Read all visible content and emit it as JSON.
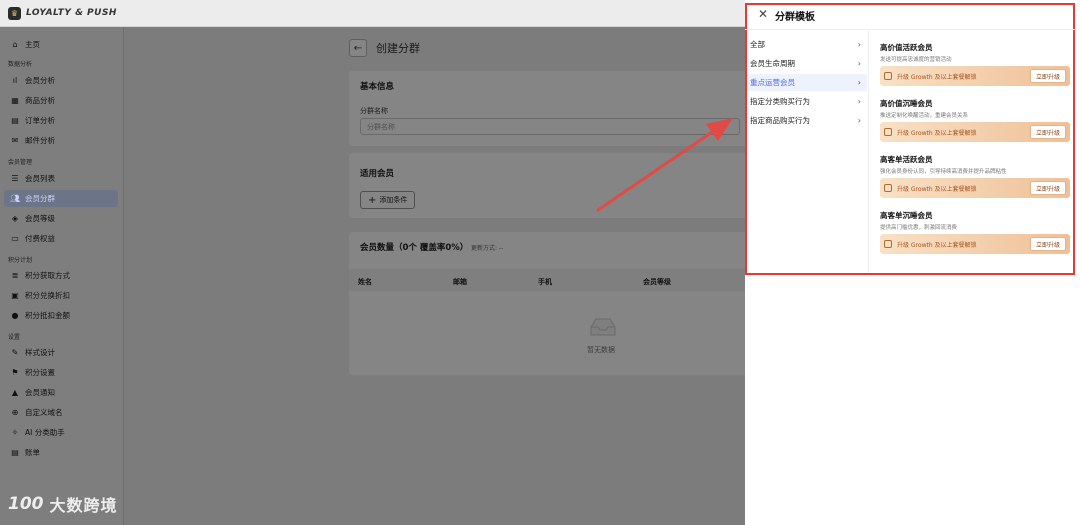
{
  "app": {
    "brand": "LOYALTY & PUSH"
  },
  "sidebar": {
    "home": "主页",
    "sections": [
      "数据分析",
      "会员管理",
      "积分计划",
      "设置"
    ],
    "items": [
      {
        "label": "会员分析",
        "icon": "chart-bar-icon"
      },
      {
        "label": "商品分析",
        "icon": "box-icon"
      },
      {
        "label": "订单分析",
        "icon": "document-icon"
      },
      {
        "label": "邮件分析",
        "icon": "mail-icon"
      },
      {
        "label": "会员列表",
        "icon": "list-icon"
      },
      {
        "label": "会员分群",
        "icon": "users-icon",
        "active": true
      },
      {
        "label": "会员等级",
        "icon": "diamond-icon"
      },
      {
        "label": "付费权益",
        "icon": "card-icon"
      },
      {
        "label": "积分获取方式",
        "icon": "stack-icon"
      },
      {
        "label": "积分兑换折扣",
        "icon": "coupon-icon"
      },
      {
        "label": "积分抵扣金额",
        "icon": "coin-icon"
      },
      {
        "label": "样式设计",
        "icon": "brush-icon"
      },
      {
        "label": "积分设置",
        "icon": "flag-icon"
      },
      {
        "label": "会员通知",
        "icon": "bell-icon"
      },
      {
        "label": "自定义域名",
        "icon": "globe-icon"
      },
      {
        "label": "AI 分类助手",
        "icon": "ai-icon"
      },
      {
        "label": "账单",
        "icon": "receipt-icon"
      }
    ]
  },
  "main": {
    "title": "创建分群",
    "basic_info": {
      "title": "基本信息",
      "name_label": "分群名称",
      "name_placeholder": "分群名称"
    },
    "members": {
      "title": "适用会员",
      "add_condition": "添加条件"
    },
    "count": {
      "title": "会员数量（0个 覆盖率0%）",
      "update_method": "更新方式: --",
      "columns": [
        "姓名",
        "邮箱",
        "手机",
        "会员等级"
      ],
      "empty": "暂无数据"
    }
  },
  "drawer": {
    "title": "分群模板",
    "categories": [
      {
        "label": "全部",
        "active": false
      },
      {
        "label": "会员生命周期",
        "active": false
      },
      {
        "label": "重点运营会员",
        "active": true
      },
      {
        "label": "指定分类购买行为",
        "active": false
      },
      {
        "label": "指定商品购买行为",
        "active": false
      }
    ],
    "templates": [
      {
        "title": "高价值活跃会员",
        "desc": "发送可提高忠诚度的营销活动",
        "upgrade": "升级 Growth 及以上套餐解锁",
        "button": "立即升级"
      },
      {
        "title": "高价值沉睡会员",
        "desc": "推送定制化唤醒活动，重建会员关系",
        "upgrade": "升级 Growth 及以上套餐解锁",
        "button": "立即升级"
      },
      {
        "title": "高客单活跃会员",
        "desc": "强化会员身份认同，引导持续高消费并提升品牌粘性",
        "upgrade": "升级 Growth 及以上套餐解锁",
        "button": "立即升级"
      },
      {
        "title": "高客单沉睡会员",
        "desc": "提供高门槛优惠，刺激回流消费",
        "upgrade": "升级 Growth 及以上套餐解锁",
        "button": "立即升级"
      }
    ]
  },
  "watermark": {
    "logo": "100",
    "text": "大数跨境"
  },
  "colors": {
    "accent": "#4f6bd8",
    "highlight": "#e53935",
    "upgrade_gradient_start": "#f8e1c6",
    "upgrade_gradient_end": "#efc097"
  }
}
